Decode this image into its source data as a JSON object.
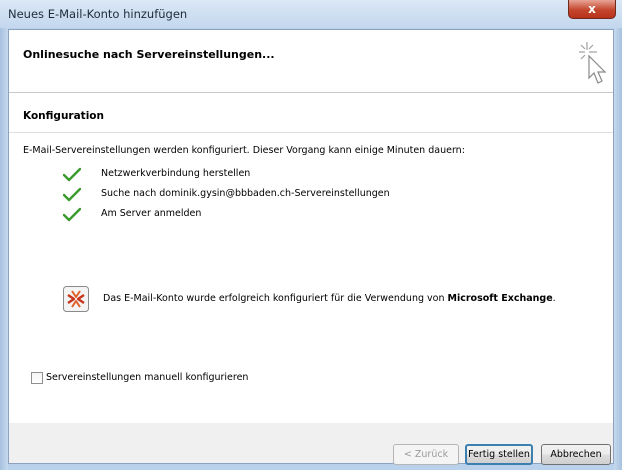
{
  "window": {
    "title": "Neues E-Mail-Konto hinzufügen",
    "close_label": "x"
  },
  "header": {
    "title": "Onlinesuche nach Servereinstellungen..."
  },
  "section": {
    "title": "Konfiguration"
  },
  "intro_text": "E-Mail-Servereinstellungen werden konfiguriert. Dieser Vorgang kann einige Minuten dauern:",
  "steps": [
    {
      "label": "Netzwerkverbindung herstellen",
      "status": "done"
    },
    {
      "label": "Suche nach dominik.gysin@bbbaden.ch-Servereinstellungen",
      "status": "done"
    },
    {
      "label": "Am Server anmelden",
      "status": "done"
    }
  ],
  "result": {
    "text": "Das E-Mail-Konto wurde erfolgreich konfiguriert für die Verwendung von",
    "product": "Microsoft Exchange",
    "suffix": "."
  },
  "manual_config": {
    "label": "Servereinstellungen manuell konfigurieren",
    "checked": false
  },
  "buttons": {
    "back": "< Zurück",
    "finish": "Fertig stellen",
    "cancel": "Abbrechen"
  },
  "colors": {
    "check": "#3a9a2c",
    "close_button": "#c4462d",
    "title_bar": "#c3d7ee"
  },
  "icons": {
    "wizard": "wizard-cursor-icon",
    "check": "check-icon",
    "exchange": "exchange-icon"
  }
}
